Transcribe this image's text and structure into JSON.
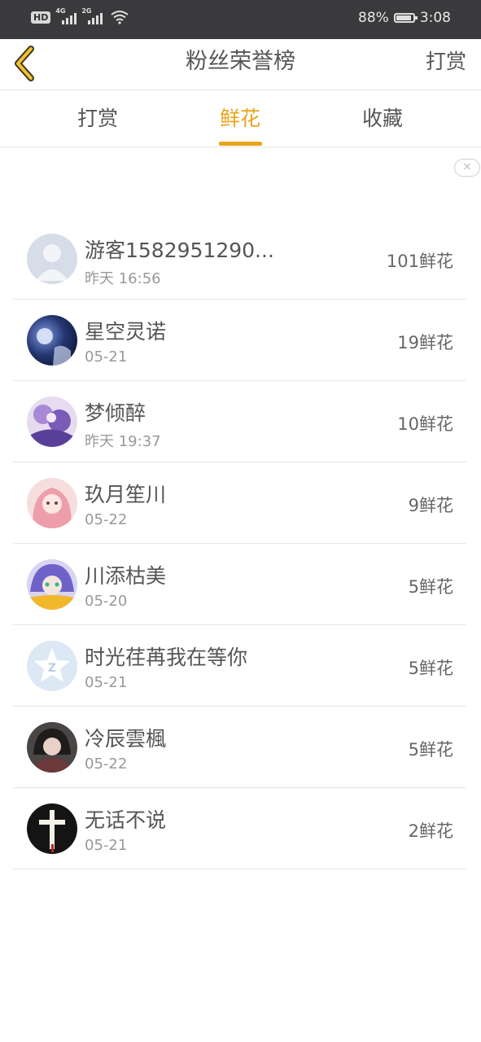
{
  "status_bar": {
    "hd_label": "HD",
    "signal1_label": "4G",
    "signal2_label": "2G",
    "battery_percent": "88%",
    "battery_level": 0.88,
    "time": "3:08"
  },
  "header": {
    "title": "粉丝荣誉榜",
    "right_action": "打赏",
    "accent_color": "#e8a41c"
  },
  "tabs": [
    {
      "label": "打赏",
      "active": false
    },
    {
      "label": "鲜花",
      "active": true
    },
    {
      "label": "收藏",
      "active": false
    }
  ],
  "close_icon": "×",
  "fans": [
    {
      "name": "游客1582951290...",
      "time": "昨天 16:56",
      "flowers": "101鲜花",
      "avatar": "default-person-avatar"
    },
    {
      "name": "星空灵诺",
      "time": "05-21",
      "flowers": "19鲜花",
      "avatar": "night-sky-avatar"
    },
    {
      "name": "梦倾醉",
      "time": "昨天 19:37",
      "flowers": "10鲜花",
      "avatar": "anime-purple-avatar"
    },
    {
      "name": "玖月笙川",
      "time": "05-22",
      "flowers": "9鲜花",
      "avatar": "anime-pink-avatar"
    },
    {
      "name": "川添枯美",
      "time": "05-20",
      "flowers": "5鲜花",
      "avatar": "anime-blue-hair-avatar"
    },
    {
      "name": "时光荏苒我在等你",
      "time": "05-21",
      "flowers": "5鲜花",
      "avatar": "qq-star-avatar"
    },
    {
      "name": "冷辰雲楓",
      "time": "05-22",
      "flowers": "5鲜花",
      "avatar": "anime-dark-avatar"
    },
    {
      "name": "无话不说",
      "time": "05-21",
      "flowers": "2鲜花",
      "avatar": "cross-avatar"
    }
  ]
}
